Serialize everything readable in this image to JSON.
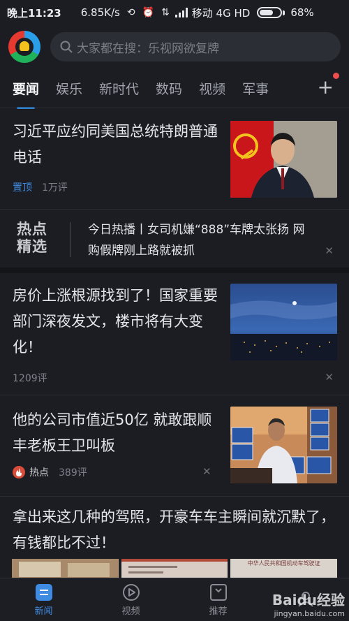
{
  "status": {
    "time": "晚上11:23",
    "speed": "6.85K/s",
    "carrier": "移动 4G HD",
    "battery_pct": "68%",
    "battery_level": 0.68
  },
  "header": {
    "logo_icon": "tencent-news-logo",
    "search_placeholder": "大家都在搜：乐视网欲复牌"
  },
  "tabs": [
    "要闻",
    "娱乐",
    "新时代",
    "数码",
    "视频",
    "军事"
  ],
  "feed": {
    "item1": {
      "title": "习近平应约同美国总统特朗普通电话",
      "tag": "置顶",
      "comments": "1万评"
    },
    "hot": {
      "logo": "热点精选",
      "text": "今日热播丨女司机嫌“888”车牌太张扬 网购假牌刚上路就被抓"
    },
    "item2": {
      "title": "房价上涨根源找到了！国家重要部门深夜发文，楼市将有大变化！",
      "comments": "1209评"
    },
    "item3": {
      "title": "他的公司市值近50亿 就敢跟顺丰老板王卫叫板",
      "tag": "热点",
      "comments": "389评"
    },
    "item4": {
      "title": "拿出来这几种的驾照，开豪车车主瞬间就沉默了，有钱都比不过！",
      "thumb_text": "中华人民共和国机动车驾驶证"
    }
  },
  "bottom_nav": [
    {
      "label": "新闻",
      "icon": "news-icon"
    },
    {
      "label": "视频",
      "icon": "play-icon"
    },
    {
      "label": "推荐",
      "icon": "bookmark-icon"
    }
  ],
  "watermark": {
    "main": "Baidu经验",
    "sub": "jingyan.baidu.com"
  },
  "colors": {
    "accent": "#3f8be1",
    "background": "#1c1d22"
  }
}
